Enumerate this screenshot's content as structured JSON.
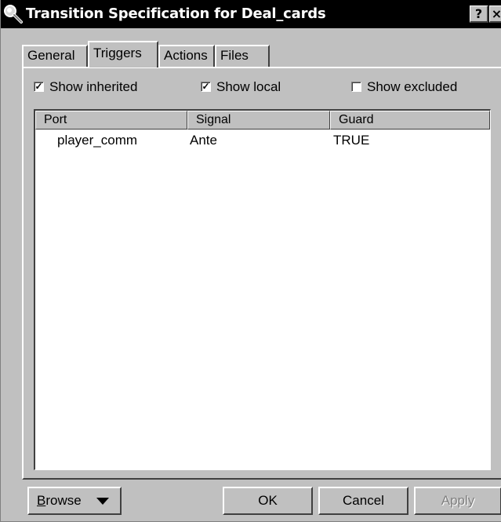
{
  "window": {
    "title": "Transition Specification for Deal_cards",
    "help_button": "?",
    "close_button": "×",
    "icon": "magnifier-icon"
  },
  "tabs": [
    {
      "label": "General",
      "active": false
    },
    {
      "label": "Triggers",
      "active": true
    },
    {
      "label": "Actions",
      "active": false
    },
    {
      "label": "Files",
      "active": false
    }
  ],
  "filters": {
    "show_inherited": {
      "label": "Show inherited",
      "checked": true
    },
    "show_local": {
      "label": "Show local",
      "checked": true
    },
    "show_excluded": {
      "label": "Show excluded",
      "checked": false
    }
  },
  "triggers_table": {
    "columns": [
      "Port",
      "Signal",
      "Guard"
    ],
    "rows": [
      {
        "port": "player_comm",
        "signal": "Ante",
        "guard": "TRUE"
      }
    ]
  },
  "buttons": {
    "browse_first": "B",
    "browse_rest": "rowse",
    "ok": "OK",
    "cancel": "Cancel",
    "apply": "Apply"
  },
  "colors": {
    "titlebar": "#000000",
    "dialog_face": "#c0c0c0",
    "list_background": "#ffffff"
  }
}
